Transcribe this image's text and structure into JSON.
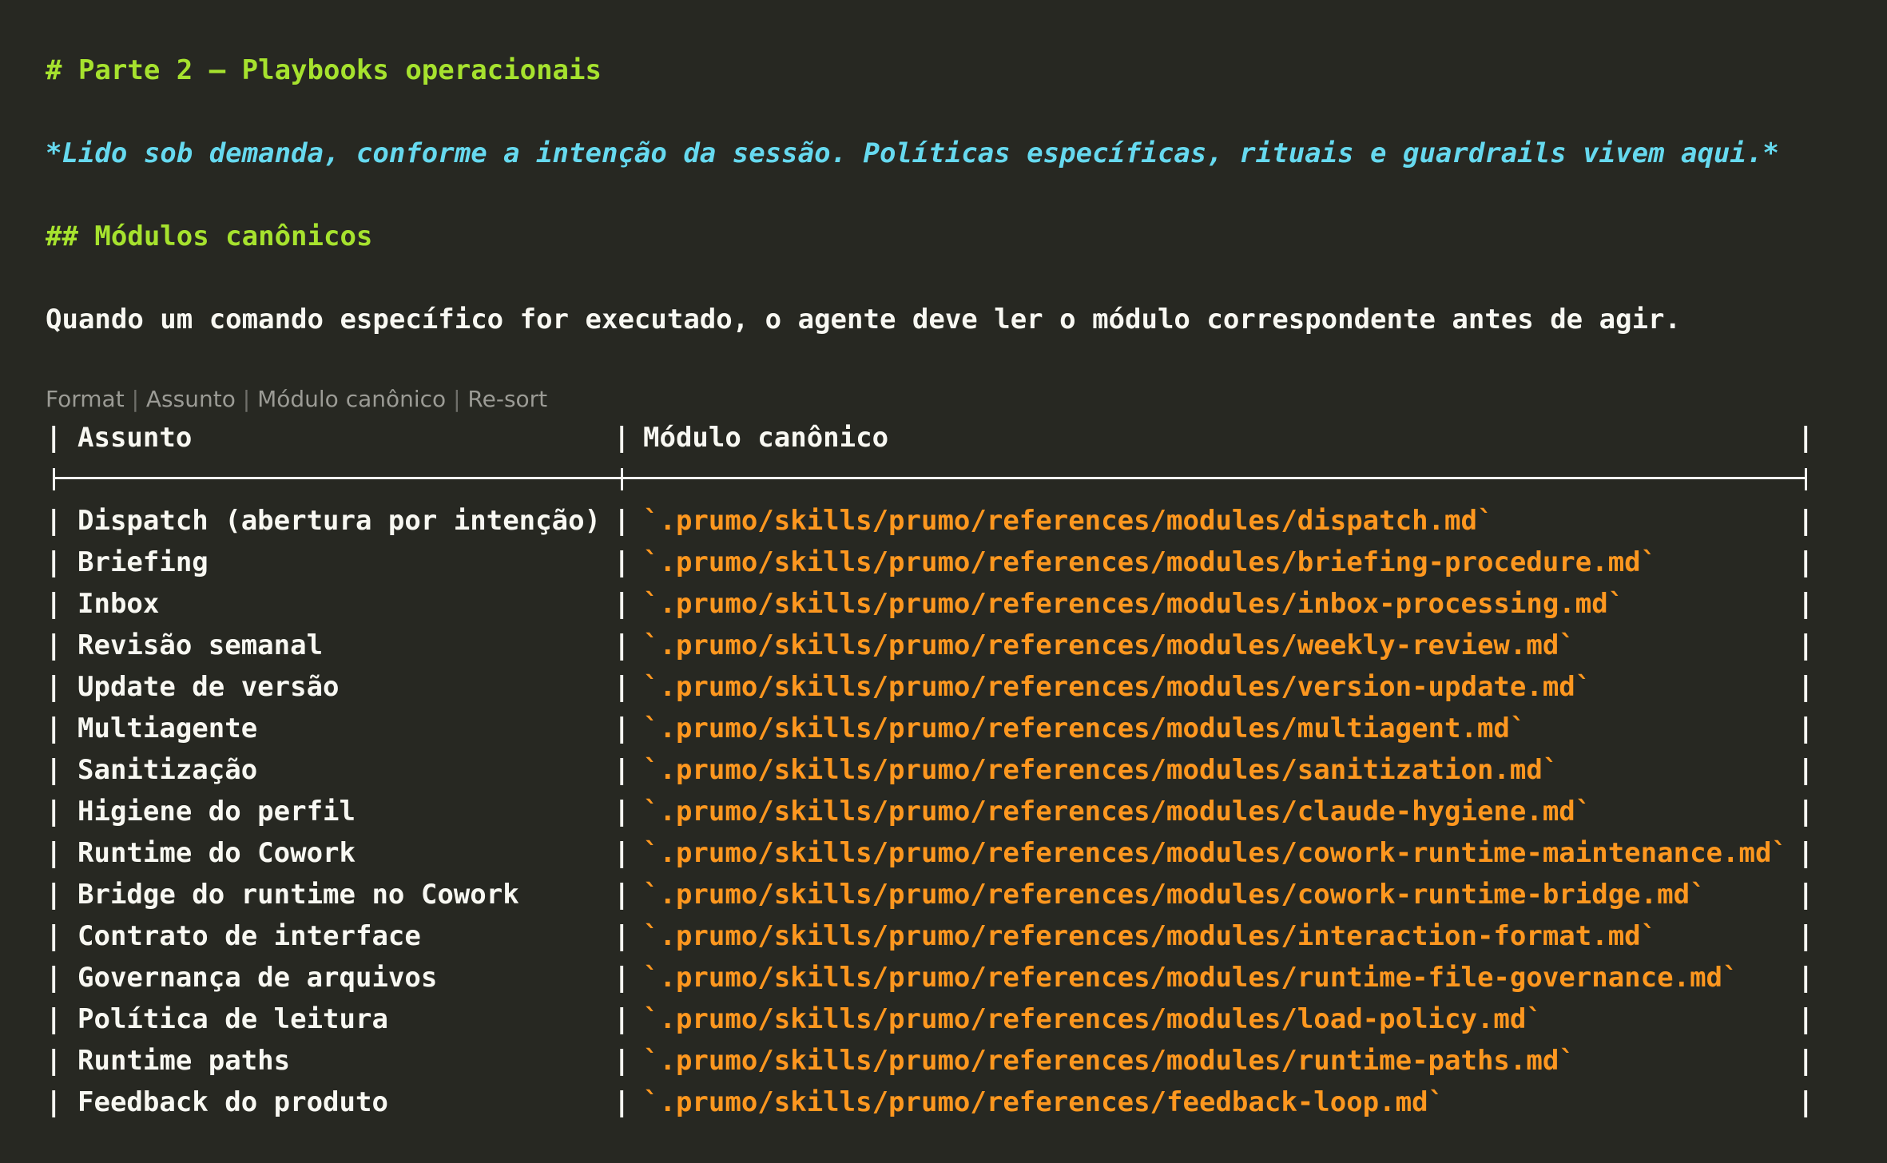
{
  "heading1": "# Parte 2 — Playbooks operacionais",
  "emphasis": "*Lido sob demanda, conforme a intenção da sessão. Políticas específicas, rituais e guardrails vivem aqui.*",
  "heading2": "## Módulos canônicos",
  "paragraph": "Quando um comando específico for executado, o agente deve ler o módulo correspondente antes de agir.",
  "toolbar": {
    "format": "Format",
    "sep": " | ",
    "assunto": "Assunto",
    "modulo": "Módulo canônico",
    "resort": "Re-sort"
  },
  "table": {
    "header": {
      "subject": "Assunto",
      "module": "Módulo canônico"
    },
    "rows": [
      {
        "subject": "Dispatch (abertura por intenção)",
        "module": "`.prumo/skills/prumo/references/modules/dispatch.md`"
      },
      {
        "subject": "Briefing",
        "module": "`.prumo/skills/prumo/references/modules/briefing-procedure.md`"
      },
      {
        "subject": "Inbox",
        "module": "`.prumo/skills/prumo/references/modules/inbox-processing.md`"
      },
      {
        "subject": "Revisão semanal",
        "module": "`.prumo/skills/prumo/references/modules/weekly-review.md`"
      },
      {
        "subject": "Update de versão",
        "module": "`.prumo/skills/prumo/references/modules/version-update.md`"
      },
      {
        "subject": "Multiagente",
        "module": "`.prumo/skills/prumo/references/modules/multiagent.md`"
      },
      {
        "subject": "Sanitização",
        "module": "`.prumo/skills/prumo/references/modules/sanitization.md`"
      },
      {
        "subject": "Higiene do perfil",
        "module": "`.prumo/skills/prumo/references/modules/claude-hygiene.md`"
      },
      {
        "subject": "Runtime do Cowork",
        "module": "`.prumo/skills/prumo/references/modules/cowork-runtime-maintenance.md`"
      },
      {
        "subject": "Bridge do runtime no Cowork",
        "module": "`.prumo/skills/prumo/references/modules/cowork-runtime-bridge.md`"
      },
      {
        "subject": "Contrato de interface",
        "module": "`.prumo/skills/prumo/references/modules/interaction-format.md`"
      },
      {
        "subject": "Governança de arquivos",
        "module": "`.prumo/skills/prumo/references/modules/runtime-file-governance.md`"
      },
      {
        "subject": "Política de leitura",
        "module": "`.prumo/skills/prumo/references/modules/load-policy.md`"
      },
      {
        "subject": "Runtime paths",
        "module": "`.prumo/skills/prumo/references/modules/runtime-paths.md`"
      },
      {
        "subject": "Feedback do produto",
        "module": "`.prumo/skills/prumo/references/feedback-loop.md`"
      }
    ]
  },
  "colors": {
    "background": "#272822",
    "heading": "#a6e22e",
    "emphasis": "#66d9ef",
    "text": "#f8f8f2",
    "code": "#fd971f",
    "toolbar": "#9b9b95"
  }
}
